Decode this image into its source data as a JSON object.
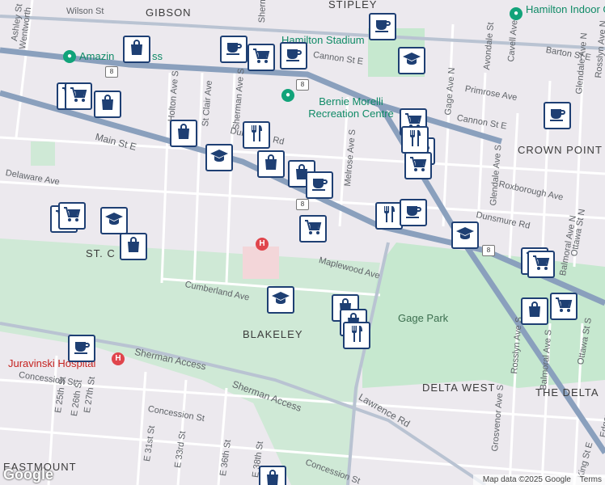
{
  "areas": [
    "GIBSON",
    "STIPLEY",
    "CROWN POINT WEST",
    "ST. C",
    "BLAKELEY",
    "DELTA WEST",
    "THE DELTA",
    "EASTMOUNT"
  ],
  "pois": [
    "Hamilton Indoor Go Karts",
    "Amazin",
    "ss",
    "Hamilton Stadium",
    "Bernie Morelli Recreation Centre",
    "Gage Park",
    "Juravinski Hospital"
  ],
  "streets": [
    "Wilson St",
    "Wentworth",
    "Ashley St",
    "Sherman",
    "Cannon St E",
    "Barton St E",
    "Main St E",
    "Delaware Ave",
    "Holton Ave S",
    "St Clair Ave",
    "Sherman Ave S",
    "Dunsmure Rd",
    "Melrose Ave S",
    "Roxborough Ave",
    "Cannon St E",
    "Primrose Ave",
    "Avondale St",
    "Cavell Ave",
    "Gage Ave N",
    "Glendale Ave N",
    "Glendale Ave S",
    "Maplewood Ave",
    "Cumberland Ave",
    "Sherman Access",
    "Sherman Access",
    "Lawrence Rd",
    "Concession St",
    "Concession St",
    "Concession St",
    "E 25th St",
    "E 26th St",
    "E 27th St",
    "E 31st St",
    "E 33rd St",
    "E 36th St",
    "Rosslyn Ave S",
    "Balmoral Ave S",
    "Grosvenor Ave S",
    "Ottawa St S",
    "King St E",
    "Rosslyn Ave N",
    "Balmoral Ave N",
    "Ottawa St N",
    "Dunsmure Rd",
    "Edgemont",
    "E 38th St"
  ],
  "routes": [
    "8",
    "8",
    "8",
    "8"
  ],
  "hospital_symbol": "H",
  "markers": [
    "coffee",
    "shopping-bag",
    "cart",
    "cart",
    "coffee",
    "cart",
    "coffee",
    "graduation",
    "shopping-bag",
    "cart",
    "shopping-bag",
    "restaurant",
    "shopping-bag",
    "graduation",
    "shopping-bag",
    "coffee",
    "coffee",
    "cart",
    "graduation",
    "shopping-bag",
    "restaurant",
    "cart",
    "coffee",
    "restaurant",
    "cart",
    "cart",
    "graduation",
    "cart",
    "cart",
    "shopping-bag",
    "graduation",
    "shopping-bag",
    "shopping-bag",
    "restaurant",
    "coffee",
    "coffee",
    "cart",
    "shopping-bag"
  ],
  "footer": {
    "copyright": "Map data ©2025 Google",
    "link": "Terms"
  },
  "logo": "Google"
}
